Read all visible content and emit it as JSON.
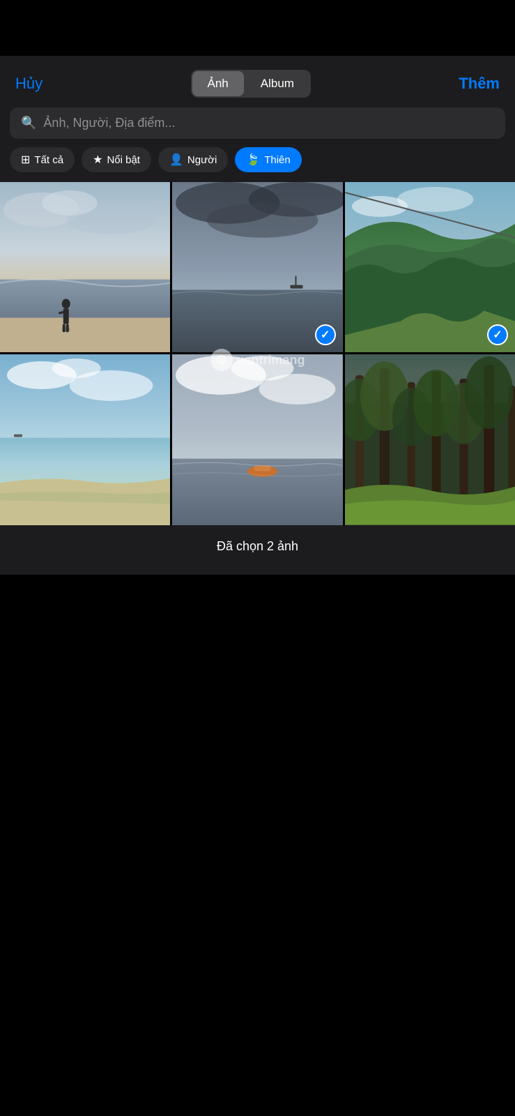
{
  "top": {
    "cancel_label": "Hủy",
    "add_label": "Thêm",
    "segment": {
      "photo_label": "Ảnh",
      "album_label": "Album",
      "active": "photo"
    }
  },
  "search": {
    "placeholder": "Ảnh, Người, Địa điểm..."
  },
  "filters": [
    {
      "id": "all",
      "label": "Tất cả",
      "icon": "grid",
      "active": false
    },
    {
      "id": "featured",
      "label": "Nổi bật",
      "icon": "star",
      "active": false
    },
    {
      "id": "people",
      "label": "Người",
      "icon": "person",
      "active": false
    },
    {
      "id": "nature",
      "label": "Thiên",
      "icon": "leaf",
      "active": true
    }
  ],
  "watermark": {
    "text": "uantrimang"
  },
  "photos": [
    {
      "id": 1,
      "selected": false,
      "cell_class": "cell-1"
    },
    {
      "id": 2,
      "selected": true,
      "cell_class": "cell-2"
    },
    {
      "id": 3,
      "selected": true,
      "cell_class": "cell-3"
    },
    {
      "id": 4,
      "selected": false,
      "cell_class": "cell-4"
    },
    {
      "id": 5,
      "selected": false,
      "cell_class": "cell-5"
    },
    {
      "id": 6,
      "selected": false,
      "cell_class": "cell-6"
    }
  ],
  "bottom": {
    "status": "Đã chọn 2 ảnh"
  }
}
